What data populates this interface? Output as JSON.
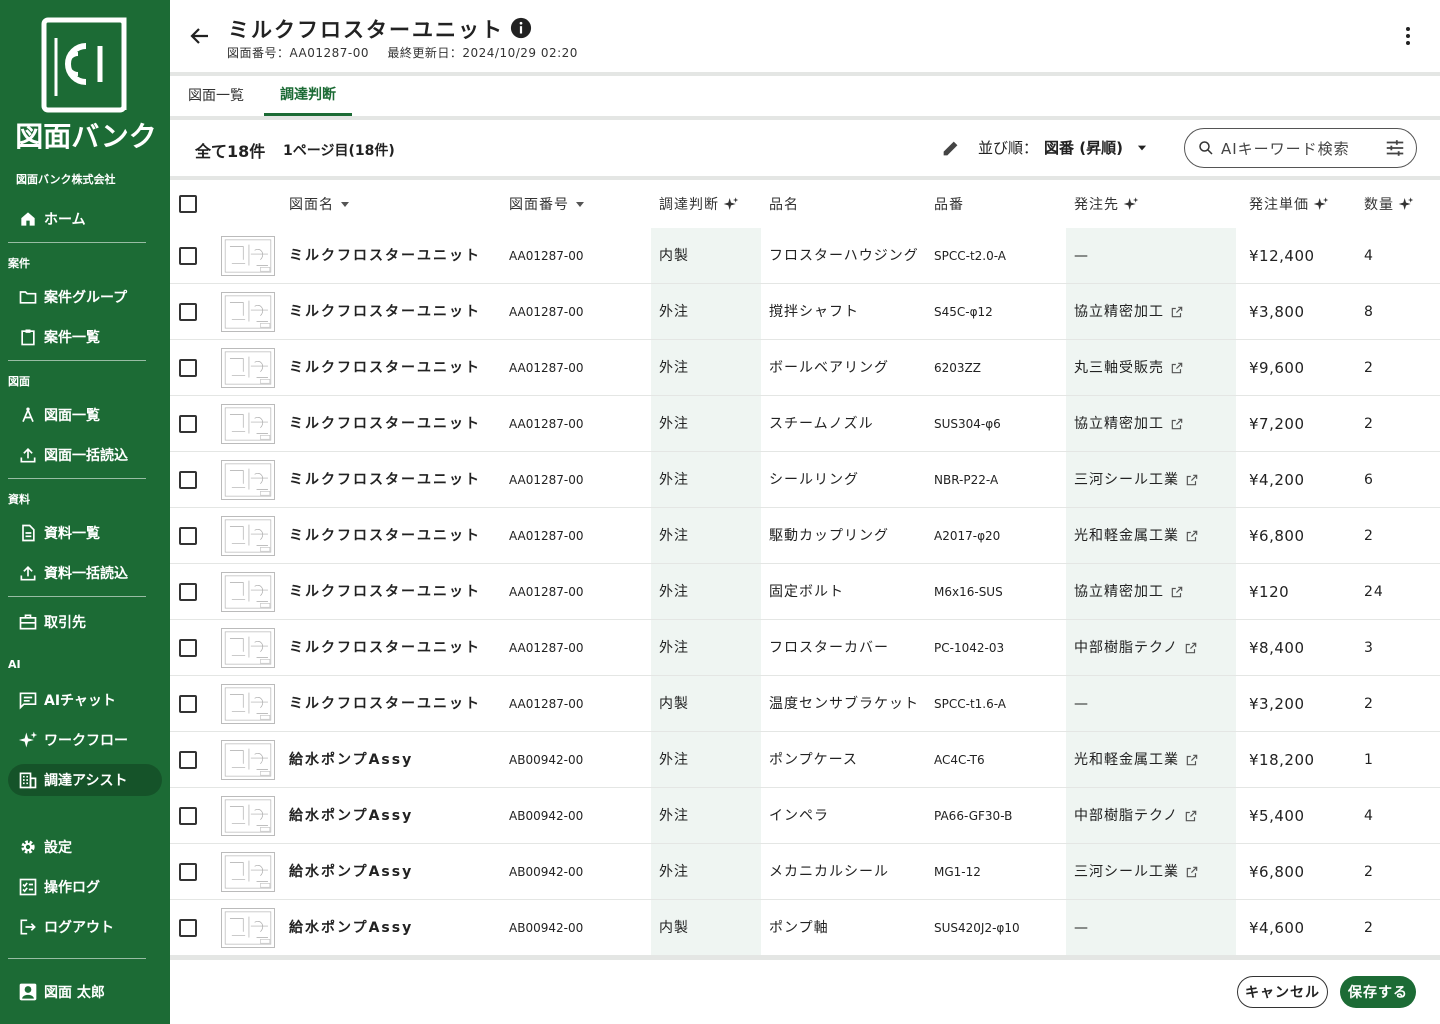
{
  "sidebar": {
    "brand": "図面バンク",
    "company": "図面バンク株式会社",
    "home": "ホーム",
    "sections": {
      "cases": "案件",
      "drawings": "図面",
      "materials": "資料",
      "ai": "AI"
    },
    "items": {
      "case_group": "案件グループ",
      "case_list": "案件一覧",
      "drawing_list": "図面一覧",
      "drawing_bulk": "図面一括読込",
      "material_list": "資料一覧",
      "material_bulk": "資料一括読込",
      "partners": "取引先",
      "ai_chat": "AIチャット",
      "workflow": "ワークフロー",
      "procurement": "調達アシスト",
      "settings": "設定",
      "log": "操作ログ",
      "logout": "ログアウト"
    },
    "user": "図面 太郎"
  },
  "header": {
    "title": "ミルクフロスターユニット",
    "drawing_no": "図面番号：AA01287-00",
    "updated": "最終更新日：2024/10/29 02:20"
  },
  "tabs": {
    "list": "図面一覧",
    "decision": "調達判断"
  },
  "toolbar": {
    "count": "全て18件",
    "page": "1ページ目(18件)",
    "sort_label": "並び順：",
    "sort_value": "図番 (昇順)",
    "search_placeholder": "AIキーワード検索"
  },
  "columns": {
    "name": "図面名",
    "number": "図面番号",
    "decision": "調達判断",
    "part": "品名",
    "partno": "品番",
    "vendor": "発注先",
    "price": "発注単価",
    "qty": "数量"
  },
  "rows": [
    {
      "name": "ミルクフロスターユニット",
      "number": "AA01287-00",
      "decision": "内製",
      "part": "フロスターハウジング",
      "partno": "SPCC-t2.0-A",
      "vendor": "—",
      "price": "¥12,400",
      "qty": "4"
    },
    {
      "name": "ミルクフロスターユニット",
      "number": "AA01287-00",
      "decision": "外注",
      "part": "撹拌シャフト",
      "partno": "S45C-φ12",
      "vendor": "協立精密加工",
      "price": "¥3,800",
      "qty": "8"
    },
    {
      "name": "ミルクフロスターユニット",
      "number": "AA01287-00",
      "decision": "外注",
      "part": "ボールベアリング",
      "partno": "6203ZZ",
      "vendor": "丸三軸受販売",
      "price": "¥9,600",
      "qty": "2"
    },
    {
      "name": "ミルクフロスターユニット",
      "number": "AA01287-00",
      "decision": "外注",
      "part": "スチームノズル",
      "partno": "SUS304-φ6",
      "vendor": "協立精密加工",
      "price": "¥7,200",
      "qty": "2"
    },
    {
      "name": "ミルクフロスターユニット",
      "number": "AA01287-00",
      "decision": "外注",
      "part": "シールリング",
      "partno": "NBR-P22-A",
      "vendor": "三河シール工業",
      "price": "¥4,200",
      "qty": "6"
    },
    {
      "name": "ミルクフロスターユニット",
      "number": "AA01287-00",
      "decision": "外注",
      "part": "駆動カップリング",
      "partno": "A2017-φ20",
      "vendor": "光和軽金属工業",
      "price": "¥6,800",
      "qty": "2"
    },
    {
      "name": "ミルクフロスターユニット",
      "number": "AA01287-00",
      "decision": "外注",
      "part": "固定ボルト",
      "partno": "M6x16-SUS",
      "vendor": "協立精密加工",
      "price": "¥120",
      "qty": "24"
    },
    {
      "name": "ミルクフロスターユニット",
      "number": "AA01287-00",
      "decision": "外注",
      "part": "フロスターカバー",
      "partno": "PC-1042-03",
      "vendor": "中部樹脂テクノ",
      "price": "¥8,400",
      "qty": "3"
    },
    {
      "name": "ミルクフロスターユニット",
      "number": "AA01287-00",
      "decision": "内製",
      "part": "温度センサブラケット",
      "partno": "SPCC-t1.6-A",
      "vendor": "—",
      "price": "¥3,200",
      "qty": "2"
    },
    {
      "name": "給水ポンプAssy",
      "number": "AB00942-00",
      "decision": "外注",
      "part": "ポンプケース",
      "partno": "AC4C-T6",
      "vendor": "光和軽金属工業",
      "price": "¥18,200",
      "qty": "1"
    },
    {
      "name": "給水ポンプAssy",
      "number": "AB00942-00",
      "decision": "外注",
      "part": "インペラ",
      "partno": "PA66-GF30-B",
      "vendor": "中部樹脂テクノ",
      "price": "¥5,400",
      "qty": "4"
    },
    {
      "name": "給水ポンプAssy",
      "number": "AB00942-00",
      "decision": "外注",
      "part": "メカニカルシール",
      "partno": "MG1-12",
      "vendor": "三河シール工業",
      "price": "¥6,800",
      "qty": "2"
    },
    {
      "name": "給水ポンプAssy",
      "number": "AB00942-00",
      "decision": "内製",
      "part": "ポンプ軸",
      "partno": "SUS420J2-φ10",
      "vendor": "—",
      "price": "¥4,600",
      "qty": "2"
    }
  ],
  "footer": {
    "cancel": "キャンセル",
    "save": "保存する"
  },
  "colors": {
    "brand": "#1c6b35",
    "column_shade": "#eff5f2"
  }
}
